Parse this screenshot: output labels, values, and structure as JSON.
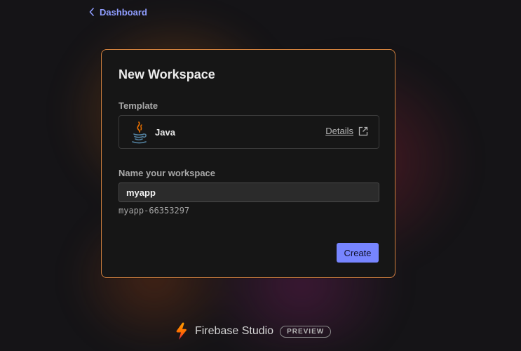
{
  "nav": {
    "back_label": "Dashboard",
    "back_icon": "chevron-left-icon"
  },
  "card": {
    "title": "New Workspace",
    "template": {
      "label": "Template",
      "name": "Java",
      "icon": "java-icon",
      "details_label": "Details",
      "details_icon": "external-link-icon"
    },
    "workspace": {
      "label": "Name your workspace",
      "value": "myapp",
      "id": "myapp-66353297"
    },
    "create_label": "Create"
  },
  "footer": {
    "brand": "Firebase Studio",
    "badge": "PREVIEW",
    "logo_icon": "firebase-studio-logo-icon"
  },
  "colors": {
    "accent": "#7785ff",
    "link": "#8f9dff",
    "card_border": "#d3823f",
    "background": "#151417"
  }
}
